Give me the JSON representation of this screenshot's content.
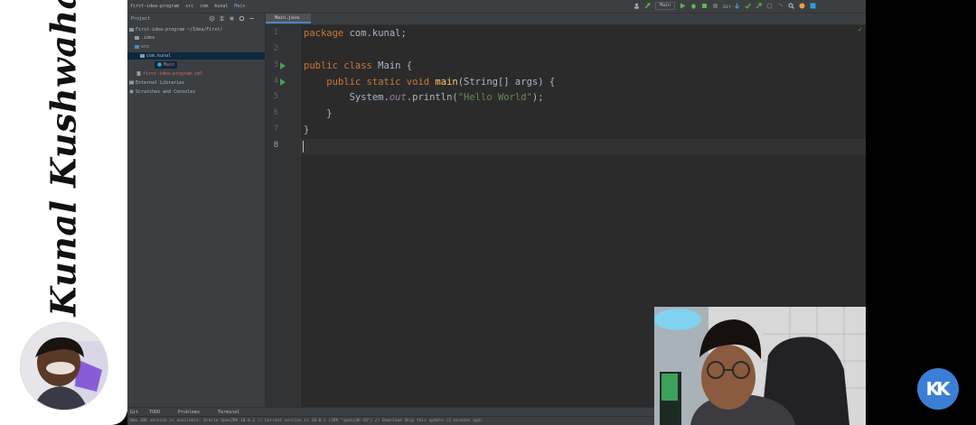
{
  "brand": {
    "name": "Kunal Kushwaha",
    "logo_text": "KK"
  },
  "ide": {
    "breadcrumb": [
      "first-idea-program",
      "src",
      "com",
      "kunal",
      "Main"
    ],
    "run_config": "Main",
    "project_panel": {
      "title": "Project",
      "tree": [
        {
          "label": "First-idea-program ~/Idea/First/",
          "indent": 0
        },
        {
          "label": ".idea",
          "indent": 1
        },
        {
          "label": "src",
          "indent": 1
        },
        {
          "label": "com.kunal",
          "indent": 2
        },
        {
          "label": "Main",
          "indent": 3
        },
        {
          "label": "first-idea-program.iml",
          "indent": 1
        },
        {
          "label": "External Libraries",
          "indent": 0
        },
        {
          "label": "Scratches and Consoles",
          "indent": 0
        }
      ]
    },
    "editor": {
      "tab_label": "Main.java",
      "line_numbers": [
        "1",
        "2",
        "3",
        "4",
        "5",
        "6",
        "7",
        "8"
      ],
      "code": {
        "l1_kw": "package",
        "l1_rest": " com.kunal;",
        "l3_kw": "public class",
        "l3_rest": " Main {",
        "l4_indent": "    ",
        "l4_kw": "public static void",
        "l4_fn": "main",
        "l4_rest": "(String[] args) {",
        "l5_indent": "        ",
        "l5_a": "System.",
        "l5_field": "out",
        "l5_b": ".println(",
        "l5_str": "\"Hello World\"",
        "l5_c": ");",
        "l6": "    }",
        "l7": "}"
      }
    },
    "tool_windows": [
      "Git",
      "TODO",
      "Problems",
      "Terminal"
    ],
    "status_text": "New JDK version is available: Oracle OpenJDK 18.0.2 // Current version is 18.0.1 (JDK \"openjdk-18\") // Download    Skip this update (2 minutes ago)"
  },
  "colors": {
    "editor_bg": "#2b2b2b",
    "keyword": "#cc7832",
    "function": "#ffc66d",
    "string": "#6a8759",
    "run_arrow": "#499c54",
    "logo_bg": "#3b7fd4"
  }
}
